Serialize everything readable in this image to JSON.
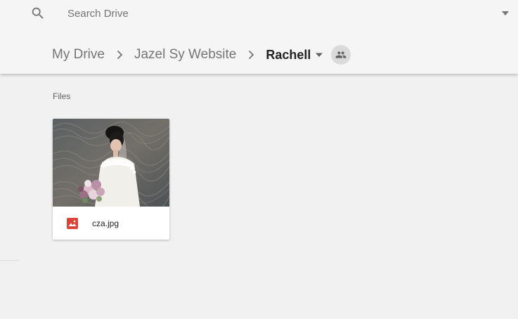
{
  "search": {
    "placeholder": "Search Drive",
    "value": ""
  },
  "breadcrumb": {
    "items": [
      {
        "label": "My Drive"
      },
      {
        "label": "Jazel Sy Website"
      },
      {
        "label": "Rachell"
      }
    ]
  },
  "main": {
    "section_label": "Files",
    "files": [
      {
        "name": "cza.jpg",
        "type_icon": "image-file-icon",
        "icon_color": "#db4437"
      }
    ]
  },
  "colors": {
    "header_bg": "#f5f5f5",
    "page_bg": "#f1f1f1",
    "share_bg": "#dadada"
  }
}
